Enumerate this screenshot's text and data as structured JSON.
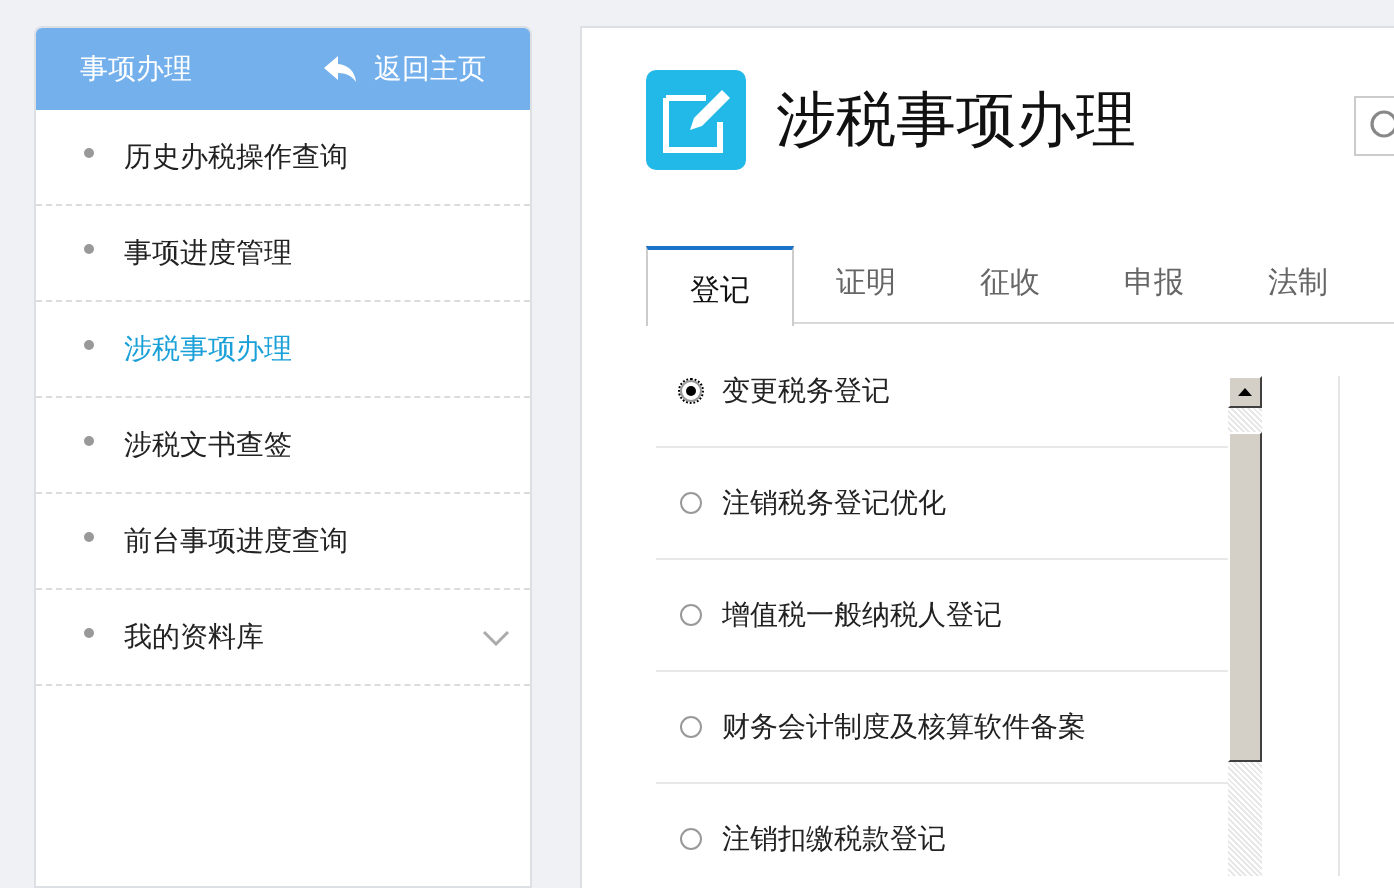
{
  "sidebar": {
    "title": "事项办理",
    "back_link": "返回主页",
    "items": [
      {
        "label": "历史办税操作查询",
        "selected": false,
        "expandable": false
      },
      {
        "label": "事项进度管理",
        "selected": false,
        "expandable": false
      },
      {
        "label": "涉税事项办理",
        "selected": true,
        "expandable": false
      },
      {
        "label": "涉税文书查签",
        "selected": false,
        "expandable": false
      },
      {
        "label": "前台事项进度查询",
        "selected": false,
        "expandable": false
      },
      {
        "label": "我的资料库",
        "selected": false,
        "expandable": true
      }
    ]
  },
  "main": {
    "title": "涉税事项办理",
    "tabs": [
      {
        "label": "登记",
        "selected": true
      },
      {
        "label": "证明",
        "selected": false
      },
      {
        "label": "征收",
        "selected": false
      },
      {
        "label": "申报",
        "selected": false
      },
      {
        "label": "法制",
        "selected": false
      }
    ],
    "options": [
      {
        "label": "变更税务登记",
        "selected": true
      },
      {
        "label": "注销税务登记优化",
        "selected": false
      },
      {
        "label": "增值税一般纳税人登记",
        "selected": false
      },
      {
        "label": "财务会计制度及核算软件备案",
        "selected": false
      },
      {
        "label": "注销扣缴税款登记",
        "selected": false
      }
    ]
  }
}
